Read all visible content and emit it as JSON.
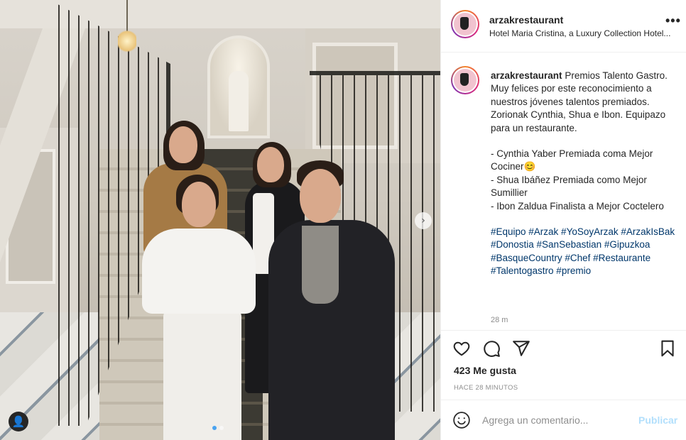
{
  "post": {
    "username": "arzakrestaurant",
    "location": "Hotel Maria Cristina, a Luxury Collection Hotel...",
    "more_glyph": "•••"
  },
  "photo": {
    "carousel_next_glyph": "›",
    "tag_icon": "user-tag-icon",
    "tag_glyph": "👤",
    "carousel_dots": 2,
    "carousel_active_index": 0
  },
  "caption": {
    "username": "arzakrestaurant",
    "text": "Premios Talento Gastro. Muy felices por este reconocimiento a nuestros jóvenes talentos premiados. Zorionak Cynthia, Shua e Ibon. Equipazo para un restaurante.",
    "line1": "- Cynthia Yaber Premiada coma Mejor Cociner😊",
    "line2": "- Shua Ibáñez Premiada como Mejor Sumillier",
    "line3": "- Ibon Zaldua Finalista a Mejor Coctelero",
    "hashtags": "#Equipo #Arzak #YoSoyArzak #ArzakIsBak #Donostia #SanSebastian #Gipuzkoa #BasqueCountry #Chef #Restaurante #Talentogastro #premio",
    "time_ago": "28 m"
  },
  "actions": {
    "like_icon": "heart-icon",
    "comment_icon": "comment-icon",
    "share_icon": "share-icon",
    "save_icon": "bookmark-icon",
    "likes": "423 Me gusta",
    "posted": "HACE 28 MINUTOS"
  },
  "comment": {
    "emoji_icon": "emoji-icon",
    "placeholder": "Agrega un comentario...",
    "publish_label": "Publicar"
  },
  "colors": {
    "link": "#00376b",
    "publish_disabled": "#b2dffc",
    "muted": "#8e8e8e",
    "carousel_active": "#4aa3f0"
  }
}
